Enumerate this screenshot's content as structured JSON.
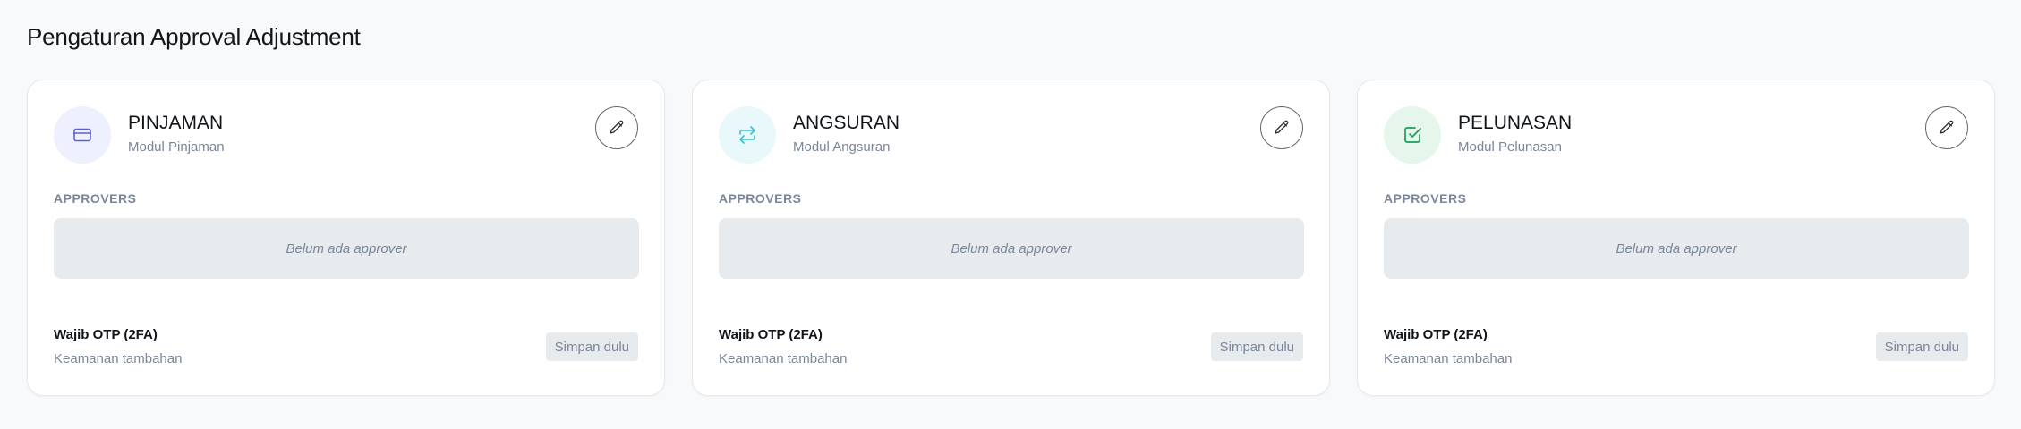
{
  "page": {
    "title": "Pengaturan Approval Adjustment"
  },
  "cards": [
    {
      "name": "PINJAMAN",
      "subtitle": "Modul Pinjaman",
      "icon": "credit-card-icon",
      "icon_bg": "#eef0fd",
      "icon_color": "#5b5fd6",
      "approvers_label": "APPROVERS",
      "approvers_empty": "Belum ada approver",
      "otp_title": "Wajib OTP (2FA)",
      "otp_subtitle": "Keamanan tambahan",
      "save_label": "Simpan dulu"
    },
    {
      "name": "ANGSURAN",
      "subtitle": "Modul Angsuran",
      "icon": "repeat-icon",
      "icon_bg": "#e9f8fb",
      "icon_color": "#3cc2cf",
      "approvers_label": "APPROVERS",
      "approvers_empty": "Belum ada approver",
      "otp_title": "Wajib OTP (2FA)",
      "otp_subtitle": "Keamanan tambahan",
      "save_label": "Simpan dulu"
    },
    {
      "name": "PELUNASAN",
      "subtitle": "Modul Pelunasan",
      "icon": "checkbox-icon",
      "icon_bg": "#e6f6ec",
      "icon_color": "#1f9d55",
      "approvers_label": "APPROVERS",
      "approvers_empty": "Belum ada approver",
      "otp_title": "Wajib OTP (2FA)",
      "otp_subtitle": "Keamanan tambahan",
      "save_label": "Simpan dulu"
    }
  ]
}
